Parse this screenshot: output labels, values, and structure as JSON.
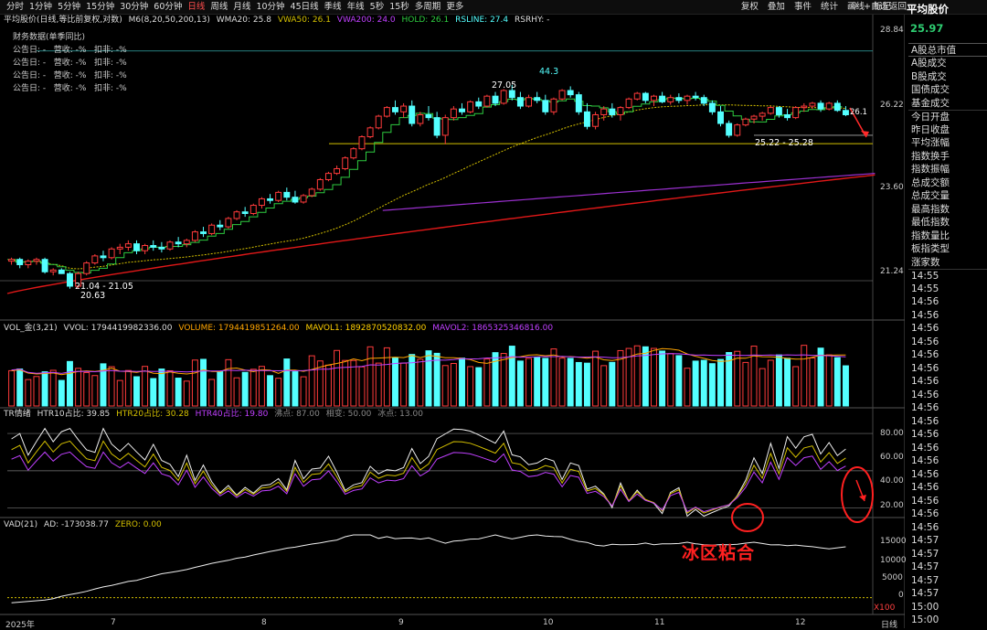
{
  "toolbar": {
    "tabs": [
      "分时",
      "1分钟",
      "5分钟",
      "15分钟",
      "30分钟",
      "60分钟",
      "日线",
      "周线",
      "月线",
      "10分钟",
      "45日线",
      "季线",
      "年线",
      "5秒",
      "15秒",
      "多周期",
      "更多"
    ],
    "active": "日线",
    "right": [
      "复权",
      "叠加",
      "事件",
      "统计",
      "画线",
      "标记"
    ],
    "self_select": "+自选",
    "back": "返回"
  },
  "window_title": "平均股价",
  "main_legend": {
    "name": "平均股价(日线,等比前复权,对数)",
    "ma": "M6(8,20,50,200,13)",
    "wma": "WMA20: 25.8",
    "vwa50": "VWA50: 26.1",
    "vwa200": "VWA200: 24.0",
    "hold": "HOLD: 26.1",
    "rsline": "RSLINE: 27.4",
    "rsrhy": "RSRHY: -"
  },
  "financial": {
    "title": "财务数据(单季同比)",
    "rows": [
      "公告日: -   营收: -%   扣非: -%",
      "公告日: -   营收: -%   扣非: -%",
      "公告日: -   营收: -%   扣非: -%",
      "公告日: -   营收: -%   扣非: -%"
    ]
  },
  "price_axis": [
    "28.84",
    "26.22",
    "23.60",
    "21.24"
  ],
  "annotations": {
    "high": "27.05",
    "peak": "44.3",
    "low_range": "21.04 - 21.05",
    "low": "20.63",
    "mid_range": "25.22 - 25.28",
    "last_marker": "26.1"
  },
  "vol_legend": {
    "name": "VOL_金(3,21)",
    "vvol": "VVOL: 1794419982336.00",
    "volume": "VOLUME: 1794419851264.00",
    "mavol1": "MAVOL1: 1892870520832.00",
    "mavol2": "MAVOL2: 1865325346816.00"
  },
  "tr_legend": {
    "name": "TR情绪",
    "htr10": "HTR10占比: 39.85",
    "htr20": "HTR20占比: 30.28",
    "htr40": "HTR40占比: 19.80",
    "hot": "沸点: 87.00",
    "mid": "相变: 50.00",
    "ice": "冰点: 13.00"
  },
  "tr_axis": [
    "80.00",
    "60.00",
    "40.00",
    "20.00"
  ],
  "vad_legend": {
    "name": "VAD(21)",
    "ad": "AD: -173038.77",
    "zero": "ZERO: 0.00"
  },
  "vad_axis": [
    "15000",
    "10000",
    "5000",
    "0"
  ],
  "x100": "X100",
  "ice_text": "冰区粘合",
  "x_axis": [
    "2025年",
    "7",
    "8",
    "9",
    "10",
    "11",
    "12"
  ],
  "period": "日线",
  "right_panel": {
    "price": "25.97",
    "items": [
      "A股总市值",
      "A股成交",
      "B股成交",
      "国债成交",
      "基金成交",
      "今日开盘",
      "昨日收盘",
      "平均涨幅",
      "指数换手",
      "指数振幅",
      "总成交额",
      "总成交量",
      "最高指数",
      "最低指数",
      "指数量比",
      "板指类型",
      "涨家数",
      "14:55",
      "14:55",
      "14:56",
      "14:56",
      "14:56",
      "14:56",
      "14:56",
      "14:56",
      "14:56",
      "14:56",
      "14:56",
      "14:56",
      "14:56",
      "14:56",
      "14:56",
      "14:56",
      "14:56",
      "14:56",
      "14:56",
      "14:56",
      "14:57",
      "14:57",
      "14:57",
      "14:57",
      "14:57",
      "15:00",
      "15:00"
    ]
  },
  "colors": {
    "up": "#ff3b3b",
    "down": "#54ffff",
    "ma_green": "#2ecc40",
    "ma_yellow": "#d4c000",
    "ma_red": "#e01818",
    "ma_purple": "#9b30d0",
    "vol_mavol1": "#ffa500",
    "vol_mavol2": "#c040ff"
  },
  "chart_data": {
    "type": "candlestick",
    "title": "平均股价",
    "ylim": [
      20.4,
      29.2
    ],
    "log_scale": true,
    "candles": [
      [
        21.4,
        21.5,
        21.3,
        21.45
      ],
      [
        21.45,
        21.5,
        21.2,
        21.3
      ],
      [
        21.3,
        21.45,
        21.2,
        21.4
      ],
      [
        21.4,
        21.5,
        21.3,
        21.45
      ],
      [
        21.45,
        21.5,
        21.05,
        21.1
      ],
      [
        21.1,
        21.2,
        21.0,
        21.15
      ],
      [
        21.15,
        21.2,
        21.04,
        21.05
      ],
      [
        21.05,
        21.1,
        20.63,
        20.7
      ],
      [
        20.7,
        21.1,
        20.65,
        21.05
      ],
      [
        21.05,
        21.4,
        21.0,
        21.35
      ],
      [
        21.35,
        21.6,
        21.3,
        21.55
      ],
      [
        21.55,
        21.7,
        21.4,
        21.5
      ],
      [
        21.5,
        21.8,
        21.45,
        21.75
      ],
      [
        21.75,
        21.9,
        21.6,
        21.8
      ],
      [
        21.8,
        22.0,
        21.7,
        21.9
      ],
      [
        21.9,
        22.0,
        21.6,
        21.7
      ],
      [
        21.7,
        21.9,
        21.6,
        21.85
      ],
      [
        21.85,
        22.0,
        21.7,
        21.8
      ],
      [
        21.8,
        21.95,
        21.65,
        21.75
      ],
      [
        21.75,
        22.0,
        21.7,
        21.95
      ],
      [
        21.95,
        22.1,
        21.8,
        21.9
      ],
      [
        21.9,
        22.05,
        21.8,
        22.0
      ],
      [
        22.0,
        22.3,
        21.95,
        22.25
      ],
      [
        22.25,
        22.4,
        22.1,
        22.2
      ],
      [
        22.2,
        22.5,
        22.15,
        22.45
      ],
      [
        22.45,
        22.6,
        22.3,
        22.4
      ],
      [
        22.4,
        22.7,
        22.35,
        22.65
      ],
      [
        22.65,
        22.9,
        22.6,
        22.85
      ],
      [
        22.85,
        23.0,
        22.7,
        22.8
      ],
      [
        22.8,
        23.1,
        22.75,
        23.05
      ],
      [
        23.05,
        23.3,
        22.95,
        23.25
      ],
      [
        23.25,
        23.4,
        23.1,
        23.2
      ],
      [
        23.2,
        23.5,
        23.15,
        23.45
      ],
      [
        23.45,
        23.6,
        23.2,
        23.3
      ],
      [
        23.3,
        23.5,
        23.1,
        23.15
      ],
      [
        23.15,
        23.4,
        23.1,
        23.35
      ],
      [
        23.35,
        23.6,
        23.3,
        23.55
      ],
      [
        23.55,
        23.9,
        23.5,
        23.85
      ],
      [
        23.85,
        24.1,
        23.8,
        24.05
      ],
      [
        24.05,
        24.3,
        24.0,
        24.2
      ],
      [
        24.2,
        24.6,
        24.15,
        24.55
      ],
      [
        24.55,
        24.9,
        24.5,
        24.85
      ],
      [
        24.85,
        25.3,
        24.8,
        25.25
      ],
      [
        25.25,
        25.6,
        25.2,
        25.55
      ],
      [
        25.55,
        26.0,
        25.5,
        25.95
      ],
      [
        25.95,
        26.3,
        25.9,
        26.25
      ],
      [
        26.25,
        26.5,
        26.0,
        26.1
      ],
      [
        26.1,
        26.4,
        25.9,
        26.3
      ],
      [
        26.3,
        26.5,
        25.6,
        25.7
      ],
      [
        25.7,
        26.1,
        25.6,
        26.0
      ],
      [
        26.0,
        26.3,
        25.8,
        25.9
      ],
      [
        25.9,
        26.1,
        25.2,
        25.3
      ],
      [
        25.3,
        26.0,
        25.0,
        25.9
      ],
      [
        25.9,
        26.3,
        25.8,
        26.2
      ],
      [
        26.2,
        26.4,
        26.0,
        26.1
      ],
      [
        26.1,
        26.5,
        26.05,
        26.45
      ],
      [
        26.45,
        26.6,
        26.2,
        26.3
      ],
      [
        26.3,
        26.7,
        26.25,
        26.65
      ],
      [
        26.65,
        26.8,
        26.3,
        26.4
      ],
      [
        26.4,
        26.9,
        26.35,
        26.85
      ],
      [
        26.85,
        27.05,
        26.5,
        26.6
      ],
      [
        26.6,
        26.8,
        26.2,
        26.3
      ],
      [
        26.3,
        26.7,
        26.25,
        26.6
      ],
      [
        26.6,
        26.8,
        26.4,
        26.5
      ],
      [
        26.5,
        26.7,
        26.0,
        26.1
      ],
      [
        26.1,
        26.6,
        26.0,
        26.55
      ],
      [
        26.55,
        26.9,
        26.5,
        26.85
      ],
      [
        26.85,
        27.0,
        26.6,
        26.7
      ],
      [
        26.7,
        26.8,
        26.0,
        26.1
      ],
      [
        26.1,
        26.4,
        25.5,
        25.6
      ],
      [
        25.6,
        26.1,
        25.5,
        26.0
      ],
      [
        26.0,
        26.3,
        25.8,
        26.2
      ],
      [
        26.2,
        26.4,
        25.9,
        26.0
      ],
      [
        26.0,
        26.3,
        25.8,
        26.25
      ],
      [
        26.25,
        26.6,
        26.2,
        26.55
      ],
      [
        26.55,
        26.8,
        26.5,
        26.75
      ],
      [
        26.75,
        26.8,
        26.4,
        26.5
      ],
      [
        26.5,
        26.7,
        26.3,
        26.65
      ],
      [
        26.65,
        26.8,
        26.4,
        26.45
      ],
      [
        26.45,
        26.7,
        26.35,
        26.6
      ],
      [
        26.6,
        26.75,
        26.4,
        26.5
      ],
      [
        26.5,
        26.7,
        26.35,
        26.65
      ],
      [
        26.65,
        26.8,
        26.5,
        26.6
      ],
      [
        26.6,
        26.7,
        26.3,
        26.4
      ],
      [
        26.4,
        26.5,
        26.0,
        26.1
      ],
      [
        26.1,
        26.3,
        25.6,
        25.7
      ],
      [
        25.7,
        25.8,
        25.22,
        25.3
      ],
      [
        25.3,
        25.7,
        25.25,
        25.65
      ],
      [
        25.65,
        25.9,
        25.6,
        25.85
      ],
      [
        25.85,
        26.0,
        25.7,
        25.95
      ],
      [
        25.95,
        26.1,
        25.8,
        26.05
      ],
      [
        26.05,
        26.3,
        26.0,
        26.25
      ],
      [
        26.25,
        26.3,
        25.9,
        26.0
      ],
      [
        26.0,
        26.2,
        25.8,
        25.9
      ],
      [
        25.9,
        26.3,
        25.85,
        26.25
      ],
      [
        26.25,
        26.4,
        26.1,
        26.3
      ],
      [
        26.3,
        26.45,
        26.2,
        26.4
      ],
      [
        26.4,
        26.5,
        26.1,
        26.2
      ],
      [
        26.2,
        26.45,
        26.15,
        26.4
      ],
      [
        26.4,
        26.5,
        26.1,
        26.15
      ],
      [
        26.15,
        26.3,
        25.95,
        26.0
      ]
    ]
  }
}
